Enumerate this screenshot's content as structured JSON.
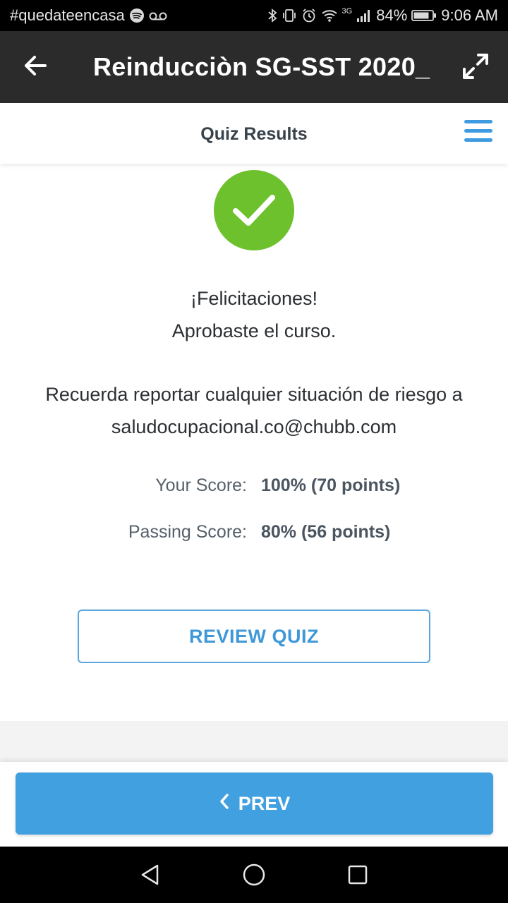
{
  "status_bar": {
    "left_text": "#quedateencasa",
    "network_label": "3G",
    "battery": "84%",
    "time": "9:06 AM"
  },
  "header": {
    "title": "Reinducciòn SG-SST 2020_",
    "back_icon": "arrow-left-icon",
    "expand_icon": "expand-icon"
  },
  "sub_header": {
    "title": "Quiz Results",
    "menu_icon": "hamburger-menu-icon"
  },
  "result": {
    "icon": "check-circle-icon",
    "icon_color": "#6cc12c",
    "line1": "¡Felicitaciones!",
    "line2": "Aprobaste el curso.",
    "line3": "Recuerda reportar cualquier situación de riesgo a",
    "line4": "saludocupacional.co@chubb.com"
  },
  "scores": {
    "your_label": "Your Score:",
    "your_value": "100% (70 points)",
    "passing_label": "Passing Score:",
    "passing_value": "80% (56 points)"
  },
  "review_button": {
    "label": "REVIEW QUIZ"
  },
  "prev_button": {
    "label": "PREV"
  },
  "colors": {
    "accent": "#41a0e0",
    "header_bg": "#2b2b2b",
    "success": "#6cc12c"
  }
}
